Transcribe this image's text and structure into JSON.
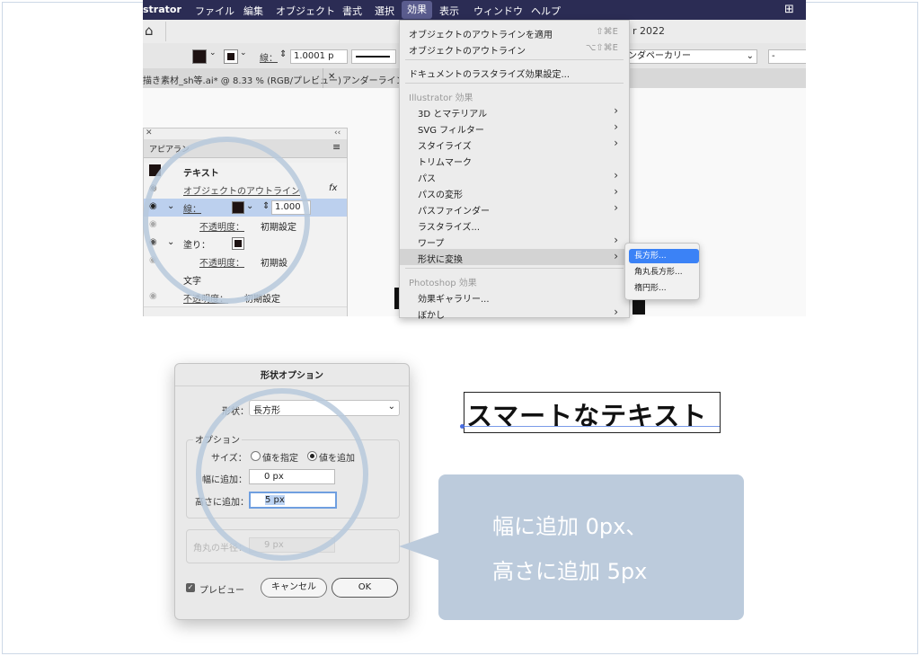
{
  "menubar": {
    "app": "strator",
    "items": [
      "ファイル",
      "編集",
      "オブジェクト",
      "書式",
      "選択",
      "効果",
      "表示",
      "ウィンドウ",
      "ヘルプ"
    ],
    "active": "効果"
  },
  "toolbar": {
    "stroke_label": "線：",
    "stroke_value": "1.0001 p",
    "font_value": "ンダペーカリー",
    "extra_value": "-",
    "version_text": "r 2022"
  },
  "tabs": {
    "tab1": "描き素材_sh等.ai* @ 8.33 % (RGB/プレビュー)",
    "tab2": "アンダーライン"
  },
  "appearance": {
    "title": "アピアラン",
    "rows": {
      "text": "テキスト",
      "outline": "オブジェクトのアウトライン",
      "stroke": "線：",
      "stroke_value": "1.000",
      "opacity1": "不透明度：",
      "default1": "初期設定",
      "fill": "塗り：",
      "opacity2": "不透明度：",
      "default2": "初期設",
      "char": "文字",
      "opacity3": "不透明度：",
      "default3": "初期設定"
    }
  },
  "effect_menu": {
    "apply_outline": "オブジェクトのアウトラインを適用",
    "apply_outline_sc": "⇧⌘E",
    "outline": "オブジェクトのアウトライン",
    "outline_sc": "⌥⇧⌘E",
    "raster_settings": "ドキュメントのラスタライズ効果設定...",
    "illustrator_head": "Illustrator 効果",
    "ill_items": [
      "3D とマテリアル",
      "SVG フィルター",
      "スタイライズ",
      "トリムマーク",
      "パス",
      "パスの変形",
      "パスファインダー",
      "ラスタライズ...",
      "ワープ",
      "形状に変換"
    ],
    "photoshop_head": "Photoshop 効果",
    "ps_items": [
      "効果ギャラリー...",
      "ぼかし"
    ],
    "submenu": [
      "長方形...",
      "角丸長方形...",
      "楕円形..."
    ]
  },
  "dialog": {
    "title": "形状オプション",
    "shape_label": "形状：",
    "shape_value": "長方形",
    "options_label": "オプション",
    "size_label": "サイズ：",
    "radio1": "値を指定",
    "radio2": "値を追加",
    "width_label": "幅に追加：",
    "width_value": "0 px",
    "height_label": "高さに追加：",
    "height_value": "5 px",
    "corner_label": "角丸の半径：",
    "corner_value": "9 px",
    "preview_label": "プレビュー",
    "cancel": "キャンセル",
    "ok": "OK"
  },
  "sample_text": "スマートなテキスト",
  "callout": {
    "line1": "幅に追加 0px、",
    "line2": "高さに追加 5px"
  },
  "colors": {
    "menubar": "#2b2c54",
    "callout": "#bccbdc",
    "ring": "#b7c9dc",
    "highlight": "#3b82f6"
  }
}
